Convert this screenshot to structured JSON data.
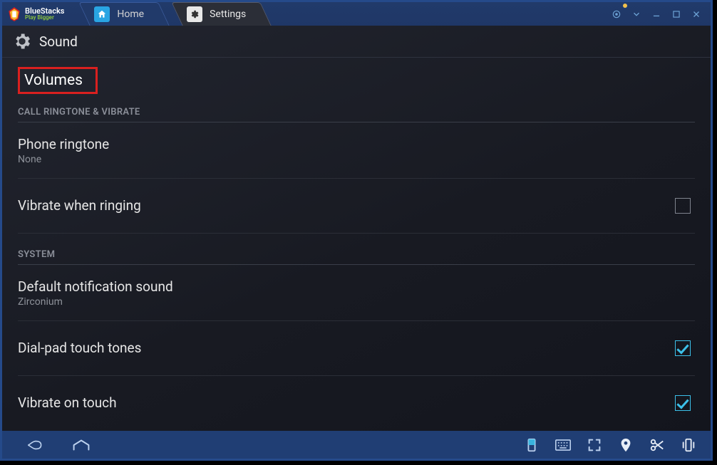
{
  "brand": {
    "name": "BlueStacks",
    "tagline": "Play Bigger"
  },
  "tabs": {
    "home": {
      "label": "Home"
    },
    "settings": {
      "label": "Settings"
    }
  },
  "page": {
    "title": "Sound"
  },
  "volumes_heading": "Volumes",
  "sections": {
    "call": {
      "title": "CALL RINGTONE & VIBRATE",
      "ringtone": {
        "title": "Phone ringtone",
        "value": "None"
      },
      "vibrate_ring": {
        "title": "Vibrate when ringing",
        "checked": false
      }
    },
    "system": {
      "title": "SYSTEM",
      "notification": {
        "title": "Default notification sound",
        "value": "Zirconium"
      },
      "dialpad": {
        "title": "Dial-pad touch tones",
        "checked": true
      },
      "vibrate_touch": {
        "title": "Vibrate on touch",
        "checked": true
      }
    }
  }
}
